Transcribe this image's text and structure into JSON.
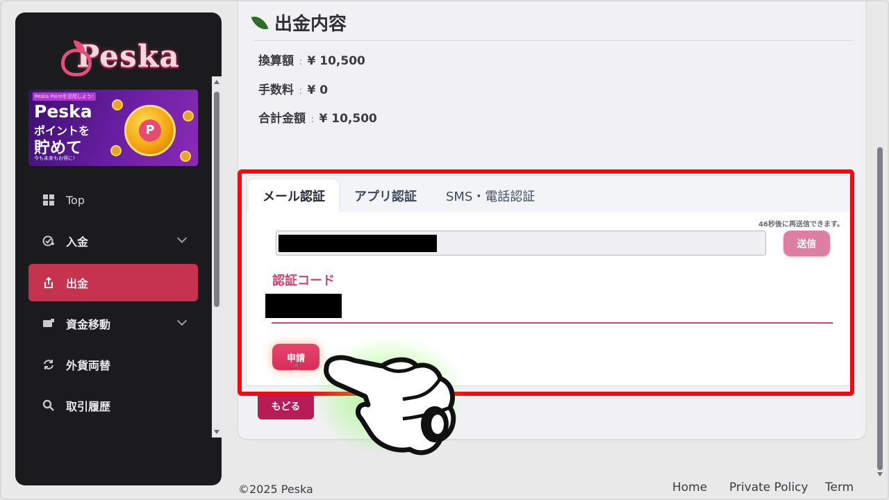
{
  "sidebar": {
    "logo_text": "Peska",
    "banner": {
      "small": "Peska Pointを活用しよう!",
      "title": "Peska",
      "line2": "ポイントを",
      "line3": "貯めて",
      "foot": "今も未来もお得に!"
    },
    "items": [
      {
        "label": "Top",
        "icon": "dashboard-icon"
      },
      {
        "label": "入金",
        "icon": "deposit-icon"
      },
      {
        "label": "出金",
        "icon": "withdraw-icon"
      },
      {
        "label": "資金移動",
        "icon": "transfer-icon"
      },
      {
        "label": "外貨両替",
        "icon": "exchange-icon"
      },
      {
        "label": "取引履歴",
        "icon": "search-icon"
      }
    ]
  },
  "main": {
    "section_title": "出金内容",
    "amounts": [
      {
        "label": "換算額",
        "sep": ":",
        "value": "¥ 10,500"
      },
      {
        "label": "手数料",
        "sep": ":",
        "value": "¥ 0"
      },
      {
        "label": "合計金額",
        "sep": ":",
        "value": "¥ 10,500"
      }
    ],
    "tabs": [
      {
        "label": "メール認証"
      },
      {
        "label": "アプリ認証"
      },
      {
        "label": "SMS・電話認証"
      }
    ],
    "resend_text": "46秒後に再送信できます。",
    "send_label": "送信",
    "code_label": "認証コード",
    "apply_label": "申請",
    "back_label": "もどる"
  },
  "footer": {
    "copyright": "©2025 Peska",
    "links": [
      "Home",
      "Private Policy",
      "Term"
    ]
  },
  "colors": {
    "accent": "#c5334f",
    "pink_label": "#d14372",
    "highlight_box": "#ec0d14",
    "sidebar_bg": "#1b1b1e"
  }
}
